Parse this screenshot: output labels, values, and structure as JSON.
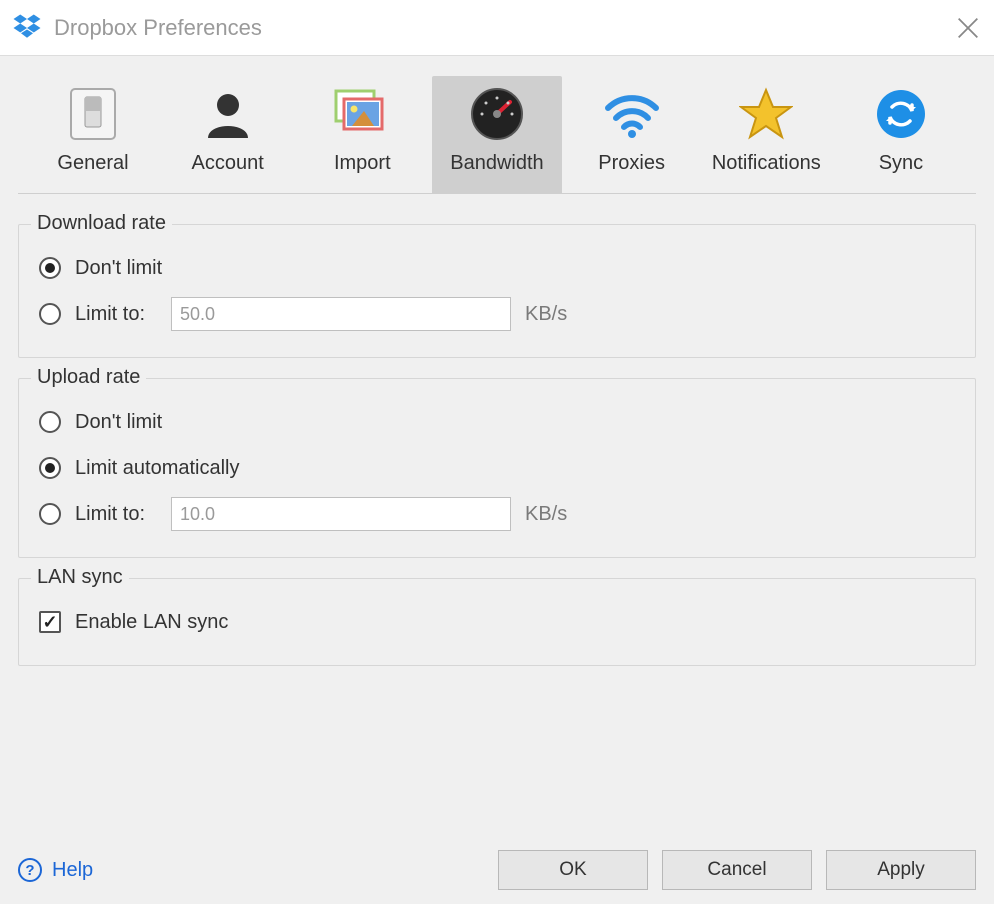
{
  "window": {
    "title": "Dropbox Preferences"
  },
  "tabs": {
    "general": "General",
    "account": "Account",
    "import": "Import",
    "bandwidth": "Bandwidth",
    "proxies": "Proxies",
    "notifications": "Notifications",
    "sync": "Sync",
    "active": "bandwidth"
  },
  "download": {
    "legend": "Download rate",
    "dont_limit": "Don't limit",
    "limit_to": "Limit to:",
    "value": "50.0",
    "unit": "KB/s",
    "selected": "dont_limit"
  },
  "upload": {
    "legend": "Upload rate",
    "dont_limit": "Don't limit",
    "limit_auto": "Limit automatically",
    "limit_to": "Limit to:",
    "value": "10.0",
    "unit": "KB/s",
    "selected": "limit_auto"
  },
  "lan": {
    "legend": "LAN sync",
    "enable": "Enable LAN sync",
    "checked": true
  },
  "buttons": {
    "help": "Help",
    "ok": "OK",
    "cancel": "Cancel",
    "apply": "Apply"
  }
}
